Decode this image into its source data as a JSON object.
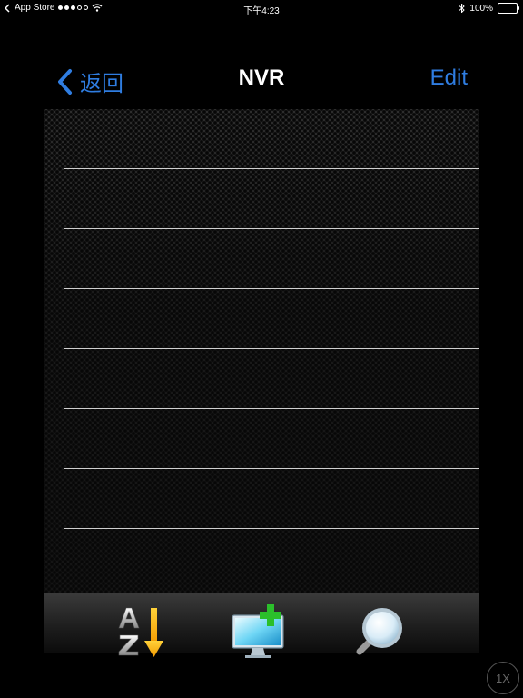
{
  "status_bar": {
    "carrier": "App Store",
    "time": "下午4:23",
    "battery_percent": "100%",
    "battery_level": 1.0,
    "signal_dots_filled": 3,
    "signal_dots_total": 5
  },
  "nav": {
    "back_label": "返回",
    "title": "NVR",
    "edit_label": "Edit",
    "accent_color": "#2f7de1"
  },
  "list": {
    "rows": [
      {
        "label": ""
      },
      {
        "label": ""
      },
      {
        "label": ""
      },
      {
        "label": ""
      },
      {
        "label": ""
      },
      {
        "label": ""
      },
      {
        "label": ""
      }
    ]
  },
  "toolbar": {
    "items": [
      {
        "icon": "sort-az-icon"
      },
      {
        "icon": "add-device-icon"
      },
      {
        "icon": "search-icon"
      }
    ]
  },
  "zoom_indicator": "1X"
}
